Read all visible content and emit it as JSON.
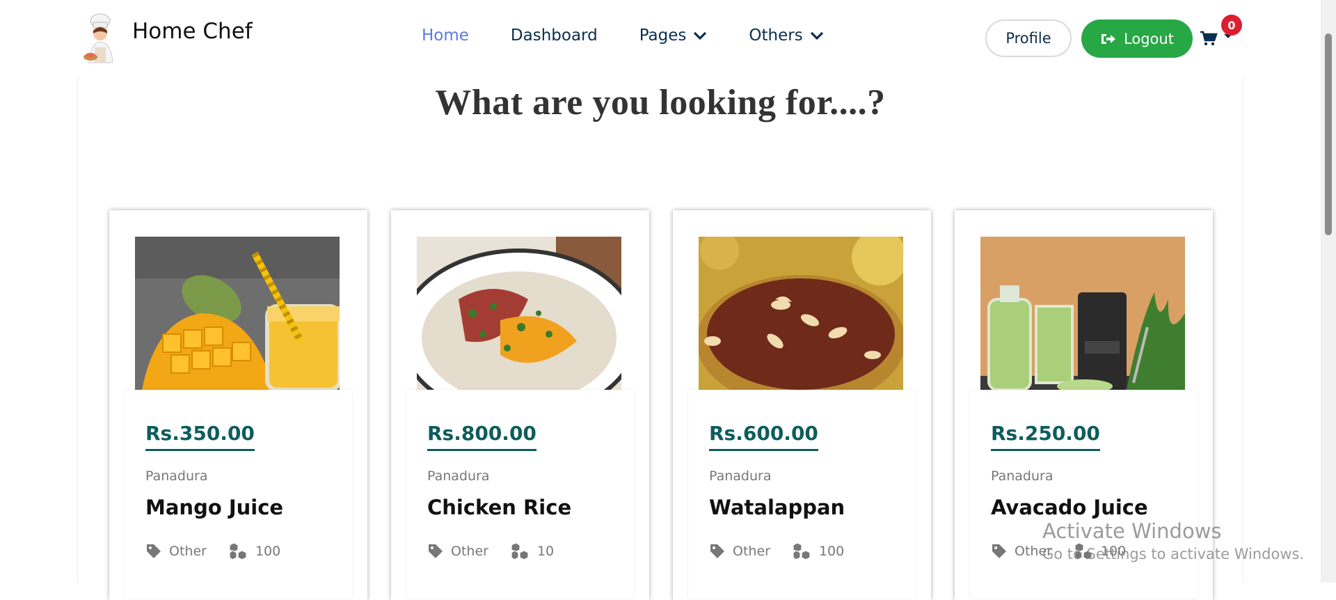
{
  "brand": {
    "name": "Home Chef",
    "logo_icon": "chef-logo-icon"
  },
  "nav": {
    "links": [
      {
        "label": "Home",
        "active": true
      },
      {
        "label": "Dashboard",
        "active": false
      },
      {
        "label": "Pages",
        "dropdown": true
      },
      {
        "label": "Others",
        "dropdown": true
      }
    ]
  },
  "actions": {
    "profile_label": "Profile",
    "logout_label": "Logout",
    "cart_count": "0"
  },
  "main": {
    "heading": "What are you looking for....?",
    "products": [
      {
        "price": "Rs.350.00",
        "location": "Panadura",
        "name": "Mango Juice",
        "category": "Other",
        "quantity": "100",
        "image": "mango-juice"
      },
      {
        "price": "Rs.800.00",
        "location": "Panadura",
        "name": "Chicken Rice",
        "category": "Other",
        "quantity": "10",
        "image": "chicken-rice"
      },
      {
        "price": "Rs.600.00",
        "location": "Panadura",
        "name": "Watalappan",
        "category": "Other",
        "quantity": "100",
        "image": "watalappan"
      },
      {
        "price": "Rs.250.00",
        "location": "Panadura",
        "name": "Avacado Juice",
        "category": "Other",
        "quantity": "100",
        "image": "avocado-juice"
      }
    ]
  },
  "watermark": {
    "title": "Activate Windows",
    "subtitle": "Go to Settings to activate Windows."
  },
  "colors": {
    "accent_green": "#28a745",
    "price_teal": "#0e5c5c",
    "nav_active": "#5b7be0",
    "nav_text": "#0b2e4e",
    "badge_red": "#dc1f2e"
  }
}
